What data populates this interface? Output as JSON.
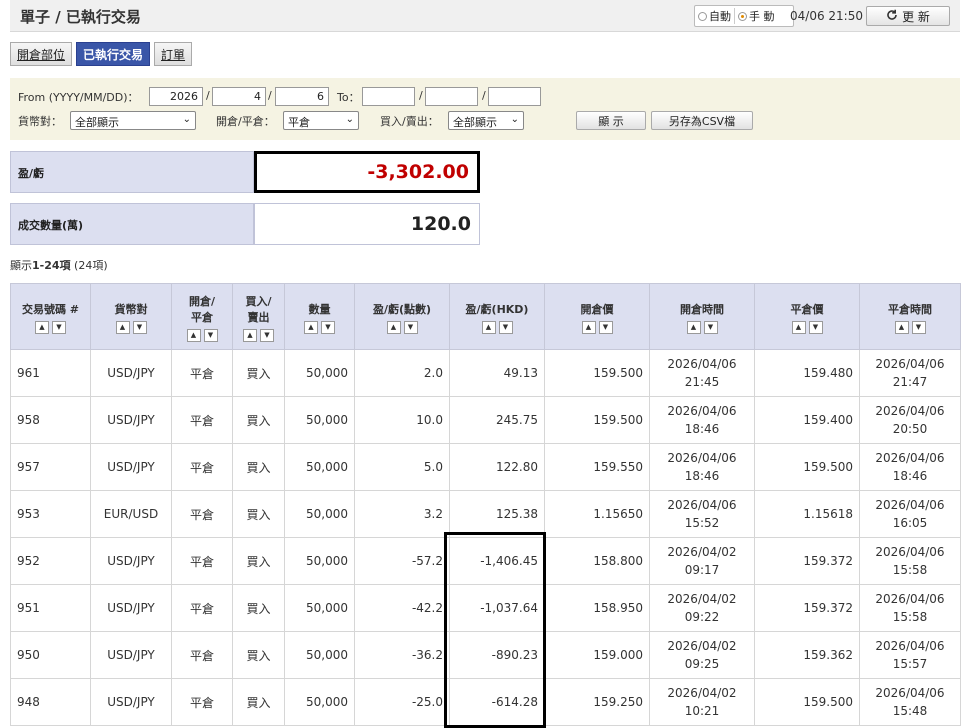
{
  "header": {
    "title": "單子 / 已執行交易",
    "mode_auto": "自動",
    "mode_manual": "手 動",
    "timestamp": "04/06 21:50",
    "refresh_label": "更 新"
  },
  "tabs": [
    {
      "label": "開倉部位",
      "active": false
    },
    {
      "label": "已執行交易",
      "active": true
    },
    {
      "label": "訂單",
      "active": false
    }
  ],
  "filter": {
    "from_label": "From (YYYY/MM/DD)：",
    "from_year": "2026",
    "from_month": "4",
    "from_day": "6",
    "to_label": "To：",
    "to_year": "",
    "to_month": "",
    "to_day": "",
    "slash": "/",
    "currency_label": "貨幣對：",
    "currency_value": "全部顯示",
    "openclose_label": "開倉/平倉：",
    "openclose_value": "平倉",
    "buysell_label": "買入/賣出：",
    "buysell_value": "全部顯示",
    "show_button": "顯 示",
    "csv_button": "另存為CSV檔"
  },
  "summary": {
    "pnl_label": "盈/虧",
    "pnl_value": "-3,302.00",
    "volume_label": "成交數量(萬)",
    "volume_value": "120.0"
  },
  "count": {
    "prefix": "顯示",
    "range": "1-24項",
    "total": " (24項)"
  },
  "table": {
    "headers": [
      "交易號碼 #",
      "貨幣對",
      "開倉/\n平倉",
      "買入/\n賣出",
      "數量",
      "盈/虧(點數)",
      "盈/虧(HKD)",
      "開倉價",
      "開倉時間",
      "平倉價",
      "平倉時間"
    ],
    "rows": [
      {
        "id": "961",
        "pair": "USD/JPY",
        "oc": "平倉",
        "bs": "買入",
        "qty": "50,000",
        "pips": "2.0",
        "hkd": "49.13",
        "open_price": "159.500",
        "open_date": "2026/04/06",
        "open_time": "21:45",
        "close_price": "159.480",
        "close_date": "2026/04/06",
        "close_time": "21:47",
        "neg": false
      },
      {
        "id": "958",
        "pair": "USD/JPY",
        "oc": "平倉",
        "bs": "買入",
        "qty": "50,000",
        "pips": "10.0",
        "hkd": "245.75",
        "open_price": "159.500",
        "open_date": "2026/04/06",
        "open_time": "18:46",
        "close_price": "159.400",
        "close_date": "2026/04/06",
        "close_time": "20:50",
        "neg": false
      },
      {
        "id": "957",
        "pair": "USD/JPY",
        "oc": "平倉",
        "bs": "買入",
        "qty": "50,000",
        "pips": "5.0",
        "hkd": "122.80",
        "open_price": "159.550",
        "open_date": "2026/04/06",
        "open_time": "18:46",
        "close_price": "159.500",
        "close_date": "2026/04/06",
        "close_time": "18:46",
        "neg": false
      },
      {
        "id": "953",
        "pair": "EUR/USD",
        "oc": "平倉",
        "bs": "買入",
        "qty": "50,000",
        "pips": "3.2",
        "hkd": "125.38",
        "open_price": "1.15650",
        "open_date": "2026/04/06",
        "open_time": "15:52",
        "close_price": "1.15618",
        "close_date": "2026/04/06",
        "close_time": "16:05",
        "neg": false
      },
      {
        "id": "952",
        "pair": "USD/JPY",
        "oc": "平倉",
        "bs": "買入",
        "qty": "50,000",
        "pips": "-57.2",
        "hkd": "-1,406.45",
        "open_price": "158.800",
        "open_date": "2026/04/02",
        "open_time": "09:17",
        "close_price": "159.372",
        "close_date": "2026/04/06",
        "close_time": "15:58",
        "neg": true
      },
      {
        "id": "951",
        "pair": "USD/JPY",
        "oc": "平倉",
        "bs": "買入",
        "qty": "50,000",
        "pips": "-42.2",
        "hkd": "-1,037.64",
        "open_price": "158.950",
        "open_date": "2026/04/02",
        "open_time": "09:22",
        "close_price": "159.372",
        "close_date": "2026/04/06",
        "close_time": "15:58",
        "neg": true
      },
      {
        "id": "950",
        "pair": "USD/JPY",
        "oc": "平倉",
        "bs": "買入",
        "qty": "50,000",
        "pips": "-36.2",
        "hkd": "-890.23",
        "open_price": "159.000",
        "open_date": "2026/04/02",
        "open_time": "09:25",
        "close_price": "159.362",
        "close_date": "2026/04/06",
        "close_time": "15:57",
        "neg": true
      },
      {
        "id": "948",
        "pair": "USD/JPY",
        "oc": "平倉",
        "bs": "買入",
        "qty": "50,000",
        "pips": "-25.0",
        "hkd": "-614.28",
        "open_price": "159.250",
        "open_date": "2026/04/02",
        "open_time": "10:21",
        "close_price": "159.500",
        "close_date": "2026/04/06",
        "close_time": "15:48",
        "neg": true
      }
    ]
  },
  "colors": {
    "accent": "#3a56a8",
    "negative": "#c00000",
    "header_bg": "#dcdff0",
    "filter_bg": "#f5f3e3",
    "link": "#2a55b0"
  },
  "icons": {
    "refresh": "refresh-icon",
    "sort_up": "sort-ascending-icon",
    "sort_down": "sort-descending-icon",
    "dropdown": "chevron-down-icon"
  }
}
